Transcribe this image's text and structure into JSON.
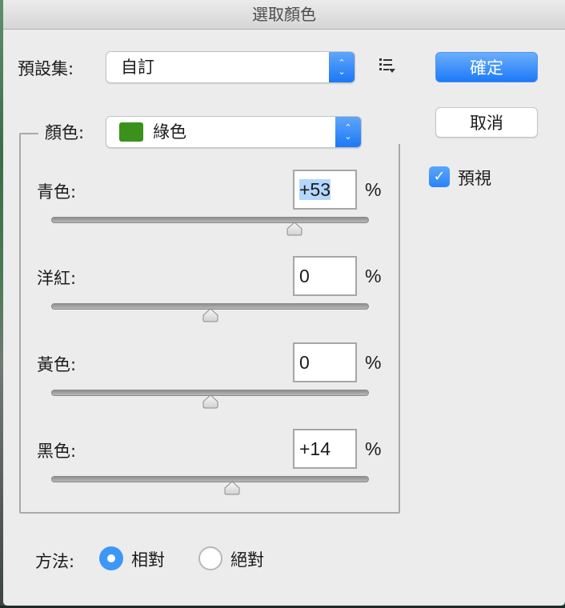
{
  "window": {
    "title": "選取顏色"
  },
  "preset": {
    "label": "預設集:",
    "value": "自訂",
    "menu_icon": "preset-options-list-icon"
  },
  "buttons": {
    "ok": "確定",
    "cancel": "取消"
  },
  "preview": {
    "label": "預視",
    "checked": true
  },
  "colors": {
    "label": "顏色:",
    "value": "綠色",
    "swatch_color": "#3a911b"
  },
  "sliders": [
    {
      "label": "青色:",
      "value": "+53",
      "numeric": 53,
      "unit": "%",
      "selected": true
    },
    {
      "label": "洋紅:",
      "value": "0",
      "numeric": 0,
      "unit": "%",
      "selected": false
    },
    {
      "label": "黃色:",
      "value": "0",
      "numeric": 0,
      "unit": "%",
      "selected": false
    },
    {
      "label": "黑色:",
      "value": "+14",
      "numeric": 14,
      "unit": "%",
      "selected": false
    }
  ],
  "slider_range": [
    -100,
    100
  ],
  "method": {
    "label": "方法:",
    "options": [
      {
        "label": "相對",
        "selected": true
      },
      {
        "label": "絕對",
        "selected": false
      }
    ]
  },
  "theme": {
    "accent": "#1d7af6",
    "selection": "#b3d7fd"
  }
}
